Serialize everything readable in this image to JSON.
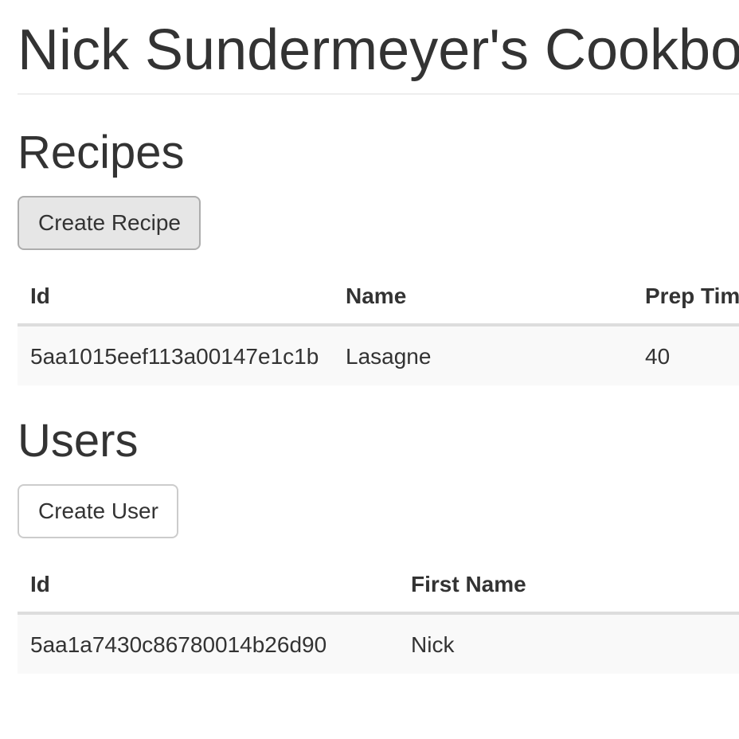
{
  "header": {
    "title": "Nick Sundermeyer's Cookbook"
  },
  "recipes": {
    "heading": "Recipes",
    "create_button": "Create Recipe",
    "columns": [
      "Id",
      "Name",
      "Prep Time"
    ],
    "rows": [
      {
        "id": "5aa1015eef113a00147e1c1b",
        "name": "Lasagne",
        "prep_time": "40"
      }
    ]
  },
  "users": {
    "heading": "Users",
    "create_button": "Create User",
    "columns": [
      "Id",
      "First Name"
    ],
    "rows": [
      {
        "id": "5aa1a7430c86780014b26d90",
        "first_name": "Nick"
      }
    ]
  }
}
